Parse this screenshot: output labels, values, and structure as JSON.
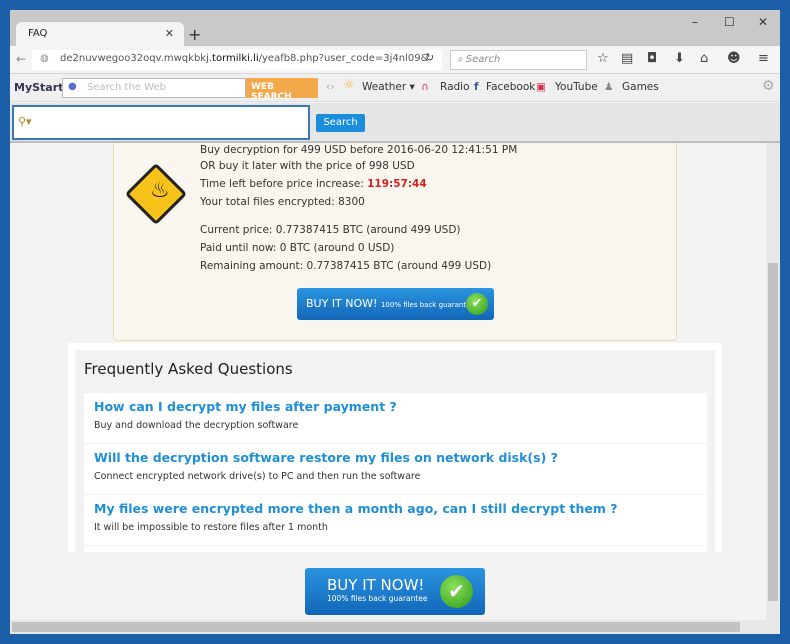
{
  "browser": {
    "tab_title": "FAQ",
    "url_prefix": "de2nuvwegoo32oqv.mwqkbkj.",
    "url_domain": "tormilki.li",
    "url_path": "/yeafb8.php?user_code=3j4nl09&",
    "search_placeholder": "Search"
  },
  "mystart": {
    "logo": "MyStart",
    "search_placeholder": "Search the Web",
    "web_search": "WEB SEARCH",
    "links": [
      "Weather",
      "Radio",
      "Facebook",
      "YouTube",
      "Games"
    ]
  },
  "searchbar": {
    "button": "Search"
  },
  "payment": {
    "line_cut": "Buy decryption for 499 USD before 2016-06-20 12:41:51 PM",
    "later": "OR buy it later with the price of 998 USD",
    "time_label": "Time left before price increase: ",
    "time_value": "119:57:44",
    "total": "Your total files encrypted: 8300",
    "current": "Current price: 0.77387415 BTC (around 499 USD)",
    "paid": "Paid until now: 0 BTC (around 0 USD)",
    "remaining": "Remaining amount: 0.77387415 BTC (around 499 USD)",
    "buy_label": "BUY IT NOW!",
    "buy_sub": "100% files back guarantee"
  },
  "faq": {
    "title": "Frequently Asked Questions",
    "items": [
      {
        "q": "How can I decrypt my files after payment ?",
        "a": "Buy and download the decryption software"
      },
      {
        "q": "Will the decryption software restore my files on network disk(s) ?",
        "a": "Connect encrypted network drive(s) to PC and then run the software"
      },
      {
        "q": "My files were encrypted more then a month ago, can I still decrypt them ?",
        "a": "It will be impossible to restore files after 1 month"
      }
    ]
  },
  "bottom_button": {
    "label": "BUY IT NOW!",
    "sub": "100% files back guarantee"
  },
  "colors": {
    "accent": "#1f8fd6",
    "timer": "#d62020",
    "frame": "#1c5fa8"
  }
}
